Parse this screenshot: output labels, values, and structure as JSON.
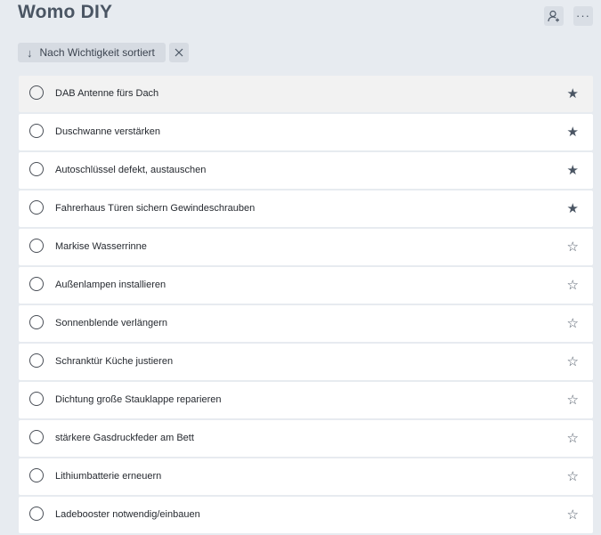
{
  "header": {
    "title": "Womo DIY",
    "share_icon": "person-add-icon",
    "more_label": "···"
  },
  "sort": {
    "arrow": "↓",
    "label": "Nach Wichtigkeit sortiert",
    "clear_label": "✕"
  },
  "tasks": [
    {
      "title": "DAB Antenne fürs Dach",
      "important": true,
      "star": "★"
    },
    {
      "title": "Duschwanne verstärken",
      "important": true,
      "star": "★"
    },
    {
      "title": "Autoschlüssel defekt, austauschen",
      "important": true,
      "star": "★"
    },
    {
      "title": "Fahrerhaus Türen sichern Gewindeschrauben",
      "important": true,
      "star": "★"
    },
    {
      "title": "Markise Wasserrinne",
      "important": false,
      "star": "☆"
    },
    {
      "title": "Außenlampen installieren",
      "important": false,
      "star": "☆"
    },
    {
      "title": "Sonnenblende verlängern",
      "important": false,
      "star": "☆"
    },
    {
      "title": "Schranktür Küche justieren",
      "important": false,
      "star": "☆"
    },
    {
      "title": "Dichtung große Stauklappe reparieren",
      "important": false,
      "star": "☆"
    },
    {
      "title": "stärkere Gasdruckfeder am Bett",
      "important": false,
      "star": "☆"
    },
    {
      "title": "Lithiumbatterie erneuern",
      "important": false,
      "star": "☆"
    },
    {
      "title": "Ladebooster notwendig/einbauen",
      "important": false,
      "star": "☆"
    }
  ]
}
